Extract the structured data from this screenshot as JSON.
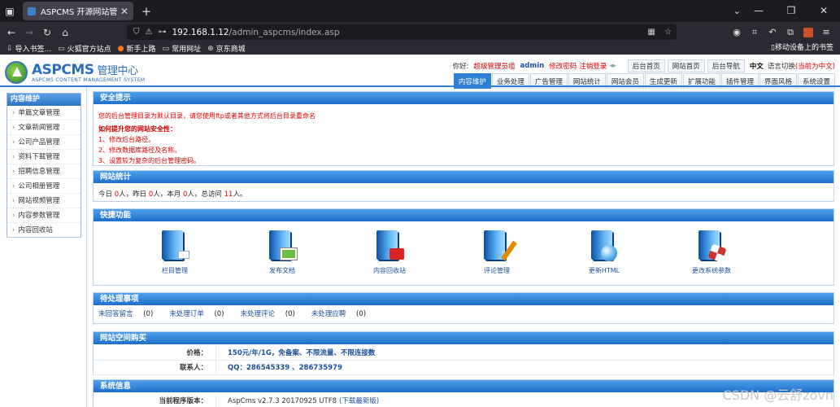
{
  "browser": {
    "tab_title": "ASPCMS 开源网站管理系统-网",
    "url_host": "192.168.1.12",
    "url_path": "/admin_aspcms/index.asp",
    "bookmarks": [
      "导入书签...",
      "火狐官方站点",
      "新手上路",
      "常用网址",
      "京东商城"
    ],
    "bookmark_right": "移动设备上的书签"
  },
  "header": {
    "logo_main": "ASPCMS",
    "logo_sub": "管理中心",
    "logo_en": "ASPCMS CONTENT MANAGEMENT SYSTEM",
    "greeting": "你好:",
    "role": "超级管理员组",
    "username": "admin",
    "change_password": "修改密码",
    "logout": "注销登录",
    "links": [
      "后台首页",
      "网站首页",
      "后台导航"
    ],
    "lang_current": "中文",
    "lang_switch": "语言切换",
    "lang_note": "(当前为中文)"
  },
  "mainnav": [
    "内容维护",
    "业务处理",
    "广告管理",
    "网站统计",
    "网站会员",
    "生成更新",
    "扩展功能",
    "插件管理",
    "界面风格",
    "系统设置"
  ],
  "sidebar": {
    "title": "内容维护",
    "items": [
      "单篇文章管理",
      "文章新闻管理",
      "公司产品管理",
      "资料下载管理",
      "招聘信息管理",
      "公司相册管理",
      "网站视频管理",
      "内容参数管理",
      "内容回收站"
    ]
  },
  "security": {
    "title": "安全提示",
    "line1": "您的后台管理目录为默认目录，请您使用ftp或者其他方式将后台目录重命名",
    "question": "如何提升您的网站安全性",
    "colon": "：",
    "steps": [
      "1、修改后台路径。",
      "2、修改数据库路径及名称。",
      "3、设置较为复杂的后台管理密码。"
    ]
  },
  "stats": {
    "title": "网站统计",
    "today_label": "今日",
    "today": "0",
    "yesterday_label": "人，昨日",
    "yesterday": "0",
    "month_label": "人，本月",
    "month": "0",
    "total_label": "人，总访问",
    "total": "11",
    "end": "人。"
  },
  "quick": {
    "title": "快捷功能",
    "items": [
      {
        "label": "栏目管理",
        "icon": "column-folder-icon"
      },
      {
        "label": "发布文档",
        "icon": "publish-doc-icon"
      },
      {
        "label": "内容回收站",
        "icon": "recycle-bin-icon"
      },
      {
        "label": "评论管理",
        "icon": "comment-manage-icon"
      },
      {
        "label": "更新HTML",
        "icon": "update-html-icon"
      },
      {
        "label": "更改系统参数",
        "icon": "system-params-icon"
      }
    ]
  },
  "todo": {
    "title": "待处理事项",
    "items": [
      {
        "label": "未回答留言",
        "count": "(0)"
      },
      {
        "label": "未处理订单",
        "count": "(0)"
      },
      {
        "label": "未处理评论",
        "count": "(0)"
      },
      {
        "label": "未处理应聘",
        "count": "(0)"
      }
    ]
  },
  "hosting": {
    "title": "网站空间购买",
    "price_label": "价格：",
    "price": "150元/年/1G，免备案、不限流量、不限连接数",
    "contact_label": "联系人：",
    "contact": "QQ：286545339 、286735979"
  },
  "sysinfo": {
    "title": "系统信息",
    "version_label": "当前程序版本：",
    "version": "AspCms v2.7.3 20170925 UTF8",
    "download": "(下载最新版)"
  },
  "watermark": "CSDN @云舒zovn"
}
